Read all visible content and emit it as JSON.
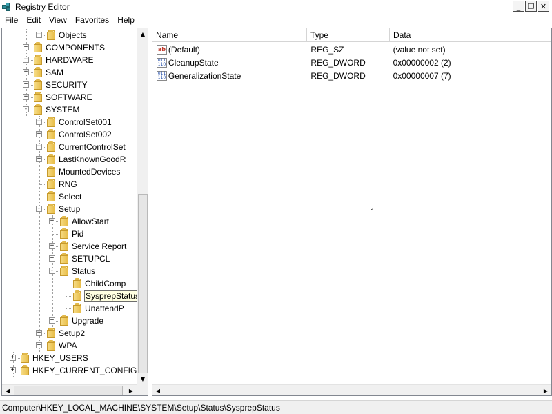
{
  "window": {
    "title": "Registry Editor",
    "controls": {
      "minimize": "_",
      "restore": "❐",
      "close": "✕"
    }
  },
  "menu": [
    "File",
    "Edit",
    "View",
    "Favorites",
    "Help"
  ],
  "tree": {
    "nodes": [
      {
        "label": "Objects",
        "expander": "+"
      },
      {
        "label": "COMPONENTS",
        "expander": "+"
      },
      {
        "label": "HARDWARE",
        "expander": "+"
      },
      {
        "label": "SAM",
        "expander": "+"
      },
      {
        "label": "SECURITY",
        "expander": "+"
      },
      {
        "label": "SOFTWARE",
        "expander": "+"
      },
      {
        "label": "SYSTEM",
        "expander": "−"
      },
      {
        "label": "ControlSet001",
        "expander": "+"
      },
      {
        "label": "ControlSet002",
        "expander": "+"
      },
      {
        "label": "CurrentControlSet",
        "expander": "+"
      },
      {
        "label": "LastKnownGoodR",
        "expander": "+"
      },
      {
        "label": "MountedDevices",
        "expander": ""
      },
      {
        "label": "RNG",
        "expander": ""
      },
      {
        "label": "Select",
        "expander": ""
      },
      {
        "label": "Setup",
        "expander": "−"
      },
      {
        "label": "AllowStart",
        "expander": "+"
      },
      {
        "label": "Pid",
        "expander": ""
      },
      {
        "label": "Service Report",
        "expander": "+"
      },
      {
        "label": "SETUPCL",
        "expander": "+"
      },
      {
        "label": "Status",
        "expander": "−"
      },
      {
        "label": "ChildComp",
        "expander": ""
      },
      {
        "label": "SysprepStatus",
        "expander": "",
        "selected": true
      },
      {
        "label": "UnattendP",
        "expander": ""
      },
      {
        "label": "Upgrade",
        "expander": "+"
      },
      {
        "label": "Setup2",
        "expander": "+"
      },
      {
        "label": "WPA",
        "expander": "+"
      },
      {
        "label": "HKEY_USERS",
        "expander": "+"
      },
      {
        "label": "HKEY_CURRENT_CONFIG",
        "expander": "+"
      }
    ]
  },
  "list": {
    "columns": [
      "Name",
      "Type",
      "Data"
    ],
    "rows": [
      {
        "icon": "string-value-icon",
        "icon_text": "ab",
        "name": "(Default)",
        "type": "REG_SZ",
        "data": "(value not set)"
      },
      {
        "icon": "dword-value-icon",
        "icon_text": "011 110",
        "name": "CleanupState",
        "type": "REG_DWORD",
        "data": "0x00000002 (2)"
      },
      {
        "icon": "dword-value-icon",
        "icon_text": "011 110",
        "name": "GeneralizationState",
        "type": "REG_DWORD",
        "data": "0x00000007 (7)"
      }
    ]
  },
  "status_bar": {
    "path": "Computer\\HKEY_LOCAL_MACHINE\\SYSTEM\\Setup\\Status\\SysprepStatus"
  },
  "colors": {
    "selection_bg": "#ffffe1",
    "folder": "#e8bd48",
    "border": "#828790"
  }
}
